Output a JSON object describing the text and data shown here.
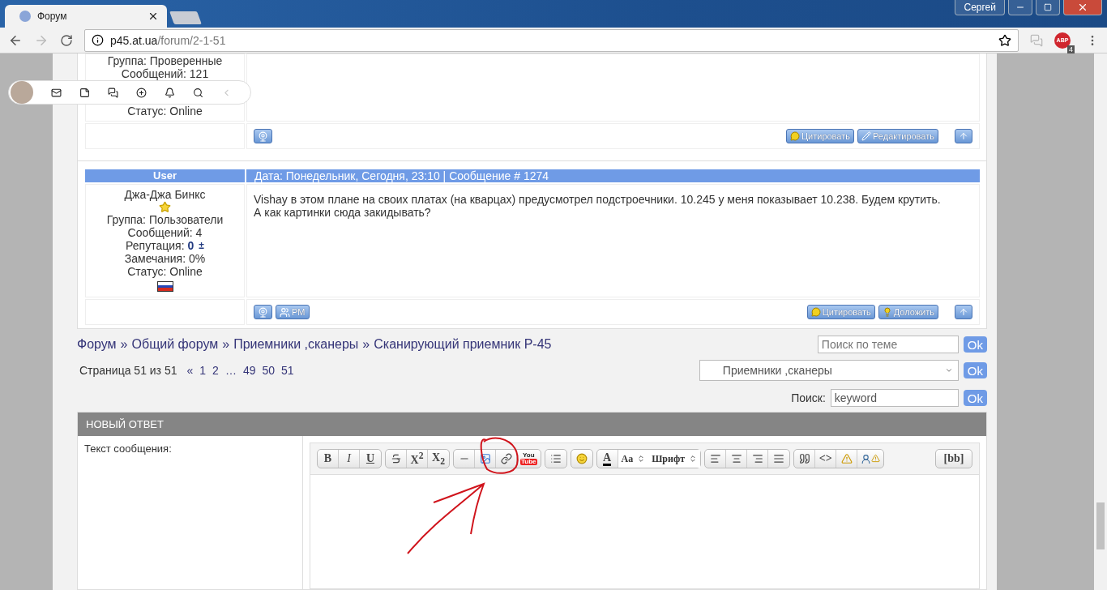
{
  "browser": {
    "tab_title": "Форум",
    "profile": "Сергей",
    "url_host": "p45.at.ua",
    "url_path": "/forum/2-1-51",
    "extension_label": "ABP",
    "extension_badge": "4"
  },
  "top_post": {
    "info": [
      "Группа: Проверенные",
      "Сообщений: 121"
    ],
    "status": "Статус: Online",
    "actions": [
      {
        "kind": "quote",
        "label": "Цитировать"
      },
      {
        "kind": "edit",
        "label": "Редактировать"
      }
    ]
  },
  "post": {
    "header_user": "User",
    "header_meta": "Дата: Понедельник, Сегодня, 23:10 | Сообщение # 1274",
    "author": "Джа-Джа Бинкс",
    "group": "Группа: Пользователи",
    "messages": "Сообщений: 4",
    "reputation_label": "Репутация:",
    "reputation_value": "0",
    "reputation_toggle": "±",
    "warnings": "Замечания: 0%",
    "status": "Статус: Online",
    "body": [
      "Vishay в этом плане на своих платах (на кварцах) предусмотрел подстроечники. 10.245 у меня показывает 10.238. Будем крутить.",
      "А как картинки сюда закидывать?"
    ],
    "pm_label": "PM",
    "actions": [
      {
        "kind": "quote",
        "label": "Цитировать"
      },
      {
        "kind": "report",
        "label": "Доложить"
      }
    ]
  },
  "breadcrumb": {
    "separator": "»",
    "items": [
      "Форум",
      "Общий форум",
      "Приемники ,сканеры",
      "Сканирующий приемник Р-45"
    ]
  },
  "topic_search": {
    "placeholder": "Поиск по теме",
    "button": "Ok"
  },
  "pagination": {
    "label": "Страница 51 из 51",
    "links": [
      "«",
      "1",
      "2",
      "…",
      "49",
      "50",
      "51"
    ]
  },
  "forum_jump": {
    "value": "Приемники ,сканеры",
    "button": "Ok"
  },
  "search": {
    "label": "Поиск:",
    "value": "keyword",
    "button": "Ok"
  },
  "reply": {
    "title": "НОВЫЙ ОТВЕТ",
    "label": "Текст сообщения:",
    "toolbar": [
      [
        {
          "kind": "bold",
          "label": "B"
        },
        {
          "kind": "italic",
          "label": "I"
        },
        {
          "kind": "underline",
          "label": "U"
        }
      ],
      [
        {
          "kind": "strike"
        },
        {
          "kind": "superscript",
          "label": "X$^{2}$"
        },
        {
          "kind": "subscript",
          "label": "X$_{2}$"
        }
      ],
      [
        {
          "kind": "rule"
        },
        {
          "kind": "image"
        },
        {
          "kind": "link"
        },
        {
          "kind": "video",
          "label": "You",
          "sublabel": "Tube"
        }
      ],
      [
        {
          "kind": "list"
        }
      ],
      [
        {
          "kind": "smiley"
        }
      ],
      [
        {
          "kind": "color",
          "label": "A"
        },
        {
          "kind": "select",
          "label": "Aa"
        },
        {
          "kind": "select",
          "label": "Шрифт"
        }
      ],
      [
        {
          "kind": "align-left"
        },
        {
          "kind": "align-center"
        },
        {
          "kind": "align-right"
        },
        {
          "kind": "align-justify"
        }
      ],
      [
        {
          "kind": "quote"
        },
        {
          "kind": "code",
          "label": "<>"
        },
        {
          "kind": "warn-text"
        },
        {
          "kind": "warn-user"
        }
      ],
      [
        {
          "kind": "mode",
          "label": "[bb]"
        }
      ]
    ]
  }
}
